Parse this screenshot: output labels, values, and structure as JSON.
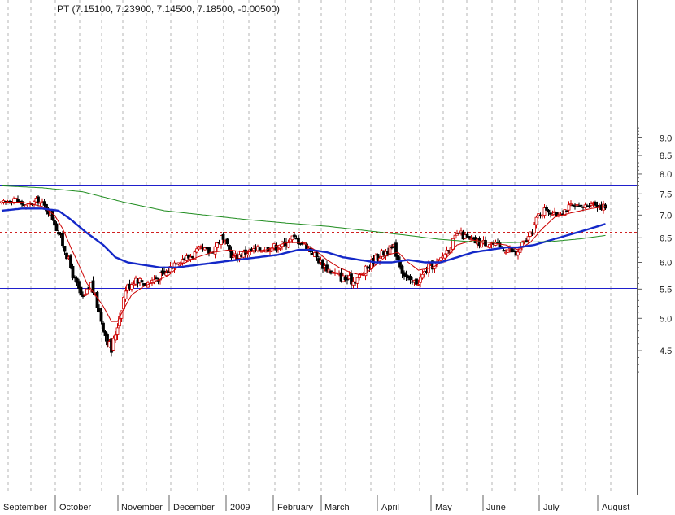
{
  "chart_data": {
    "type": "candlestick",
    "title": "PT (7.15100, 7.23900, 7.14500, 7.18500, -0.00500)",
    "price_axis": {
      "scale": "log",
      "ticks": [
        9.0,
        8.5,
        8.0,
        7.5,
        7.0,
        6.5,
        6.0,
        5.5,
        5.0,
        4.5
      ],
      "labels": [
        "9.0",
        "8.5",
        "8.0",
        "7.5",
        "7.0",
        "6.5",
        "6.0",
        "5.5",
        "5.0",
        "4.5"
      ],
      "position": "right"
    },
    "x_axis": {
      "months": [
        "September",
        "October",
        "November",
        "December",
        "2009",
        "February",
        "March",
        "April",
        "May",
        "June",
        "July",
        "August"
      ]
    },
    "grid": true,
    "horizontal_lines": [
      {
        "value": 7.7,
        "color": "#1f1fcc",
        "style": "solid"
      },
      {
        "value": 6.62,
        "color": "#d02020",
        "style": "dashed"
      },
      {
        "value": 5.52,
        "color": "#1f1fcc",
        "style": "solid"
      },
      {
        "value": 4.5,
        "color": "#1f1fcc",
        "style": "solid"
      }
    ],
    "candle_colors": {
      "up": "#cc0000",
      "down": "#000000"
    },
    "close_anchors": [
      [
        0,
        7.25
      ],
      [
        6,
        7.4
      ],
      [
        12,
        7.2
      ],
      [
        18,
        7.35
      ],
      [
        24,
        7.05
      ],
      [
        28,
        6.6
      ],
      [
        32,
        6.15
      ],
      [
        36,
        5.65
      ],
      [
        40,
        5.3
      ],
      [
        44,
        5.6
      ],
      [
        48,
        5.1
      ],
      [
        51,
        4.75
      ],
      [
        54,
        4.5
      ],
      [
        57,
        4.9
      ],
      [
        61,
        5.5
      ],
      [
        66,
        5.7
      ],
      [
        71,
        5.6
      ],
      [
        76,
        5.7
      ],
      [
        81,
        5.8
      ],
      [
        86,
        6.05
      ],
      [
        92,
        6.1
      ],
      [
        98,
        6.25
      ],
      [
        103,
        6.2
      ],
      [
        108,
        6.5
      ],
      [
        114,
        6.1
      ],
      [
        120,
        6.2
      ],
      [
        126,
        6.25
      ],
      [
        132,
        6.3
      ],
      [
        138,
        6.35
      ],
      [
        143,
        6.5
      ],
      [
        148,
        6.4
      ],
      [
        153,
        6.2
      ],
      [
        158,
        5.95
      ],
      [
        163,
        5.8
      ],
      [
        168,
        5.7
      ],
      [
        173,
        5.65
      ],
      [
        178,
        5.8
      ],
      [
        183,
        6.05
      ],
      [
        188,
        6.2
      ],
      [
        193,
        6.3
      ],
      [
        197,
        5.85
      ],
      [
        201,
        5.6
      ],
      [
        205,
        5.65
      ],
      [
        210,
        5.9
      ],
      [
        215,
        6.0
      ],
      [
        220,
        6.3
      ],
      [
        225,
        6.6
      ],
      [
        230,
        6.45
      ],
      [
        235,
        6.4
      ],
      [
        240,
        6.4
      ],
      [
        245,
        6.3
      ],
      [
        250,
        6.25
      ],
      [
        253,
        6.15
      ],
      [
        256,
        6.35
      ],
      [
        260,
        6.55
      ],
      [
        264,
        7.0
      ],
      [
        268,
        7.15
      ],
      [
        272,
        7.0
      ],
      [
        276,
        7.1
      ],
      [
        280,
        7.2
      ],
      [
        285,
        7.15
      ],
      [
        290,
        7.3
      ],
      [
        295,
        7.2
      ],
      [
        297,
        7.18
      ]
    ],
    "moving_averages": [
      {
        "color": "#cc0000",
        "width": 1,
        "anchors": [
          [
            0,
            7.3
          ],
          [
            10,
            7.3
          ],
          [
            20,
            7.2
          ],
          [
            26,
            7.0
          ],
          [
            30,
            6.7
          ],
          [
            34,
            6.3
          ],
          [
            38,
            5.95
          ],
          [
            42,
            5.6
          ],
          [
            46,
            5.4
          ],
          [
            50,
            5.2
          ],
          [
            54,
            4.95
          ],
          [
            57,
            4.95
          ],
          [
            60,
            5.15
          ],
          [
            64,
            5.4
          ],
          [
            70,
            5.55
          ],
          [
            76,
            5.65
          ],
          [
            82,
            5.75
          ],
          [
            88,
            5.95
          ],
          [
            96,
            6.1
          ],
          [
            104,
            6.2
          ],
          [
            112,
            6.25
          ],
          [
            120,
            6.2
          ],
          [
            130,
            6.25
          ],
          [
            140,
            6.4
          ],
          [
            148,
            6.4
          ],
          [
            154,
            6.25
          ],
          [
            160,
            6.05
          ],
          [
            166,
            5.9
          ],
          [
            172,
            5.8
          ],
          [
            178,
            5.75
          ],
          [
            184,
            5.95
          ],
          [
            190,
            6.15
          ],
          [
            195,
            6.2
          ],
          [
            200,
            6.0
          ],
          [
            205,
            5.85
          ],
          [
            212,
            5.9
          ],
          [
            218,
            6.05
          ],
          [
            224,
            6.35
          ],
          [
            232,
            6.45
          ],
          [
            240,
            6.4
          ],
          [
            248,
            6.35
          ],
          [
            254,
            6.25
          ],
          [
            260,
            6.4
          ],
          [
            266,
            6.7
          ],
          [
            272,
            6.95
          ],
          [
            280,
            7.05
          ],
          [
            290,
            7.15
          ],
          [
            297,
            7.2
          ]
        ]
      },
      {
        "color": "#1428c8",
        "width": 2.4,
        "anchors": [
          [
            0,
            7.1
          ],
          [
            10,
            7.15
          ],
          [
            20,
            7.15
          ],
          [
            28,
            7.1
          ],
          [
            34,
            6.9
          ],
          [
            42,
            6.6
          ],
          [
            50,
            6.35
          ],
          [
            56,
            6.1
          ],
          [
            62,
            6.0
          ],
          [
            70,
            5.95
          ],
          [
            78,
            5.9
          ],
          [
            86,
            5.9
          ],
          [
            96,
            5.95
          ],
          [
            106,
            6.0
          ],
          [
            116,
            6.05
          ],
          [
            126,
            6.1
          ],
          [
            136,
            6.15
          ],
          [
            146,
            6.25
          ],
          [
            152,
            6.25
          ],
          [
            160,
            6.2
          ],
          [
            168,
            6.1
          ],
          [
            176,
            6.05
          ],
          [
            184,
            6.0
          ],
          [
            192,
            6.0
          ],
          [
            200,
            6.05
          ],
          [
            208,
            6.0
          ],
          [
            216,
            6.0
          ],
          [
            224,
            6.1
          ],
          [
            232,
            6.2
          ],
          [
            240,
            6.25
          ],
          [
            248,
            6.3
          ],
          [
            254,
            6.3
          ],
          [
            262,
            6.35
          ],
          [
            270,
            6.45
          ],
          [
            278,
            6.55
          ],
          [
            286,
            6.65
          ],
          [
            297,
            6.8
          ]
        ]
      },
      {
        "color": "#1e8c1e",
        "width": 1,
        "anchors": [
          [
            0,
            7.7
          ],
          [
            20,
            7.65
          ],
          [
            40,
            7.55
          ],
          [
            60,
            7.3
          ],
          [
            80,
            7.1
          ],
          [
            100,
            7.0
          ],
          [
            120,
            6.9
          ],
          [
            140,
            6.82
          ],
          [
            160,
            6.75
          ],
          [
            180,
            6.65
          ],
          [
            200,
            6.55
          ],
          [
            215,
            6.47
          ],
          [
            230,
            6.42
          ],
          [
            250,
            6.4
          ],
          [
            270,
            6.42
          ],
          [
            285,
            6.48
          ],
          [
            297,
            6.55
          ]
        ]
      }
    ]
  }
}
